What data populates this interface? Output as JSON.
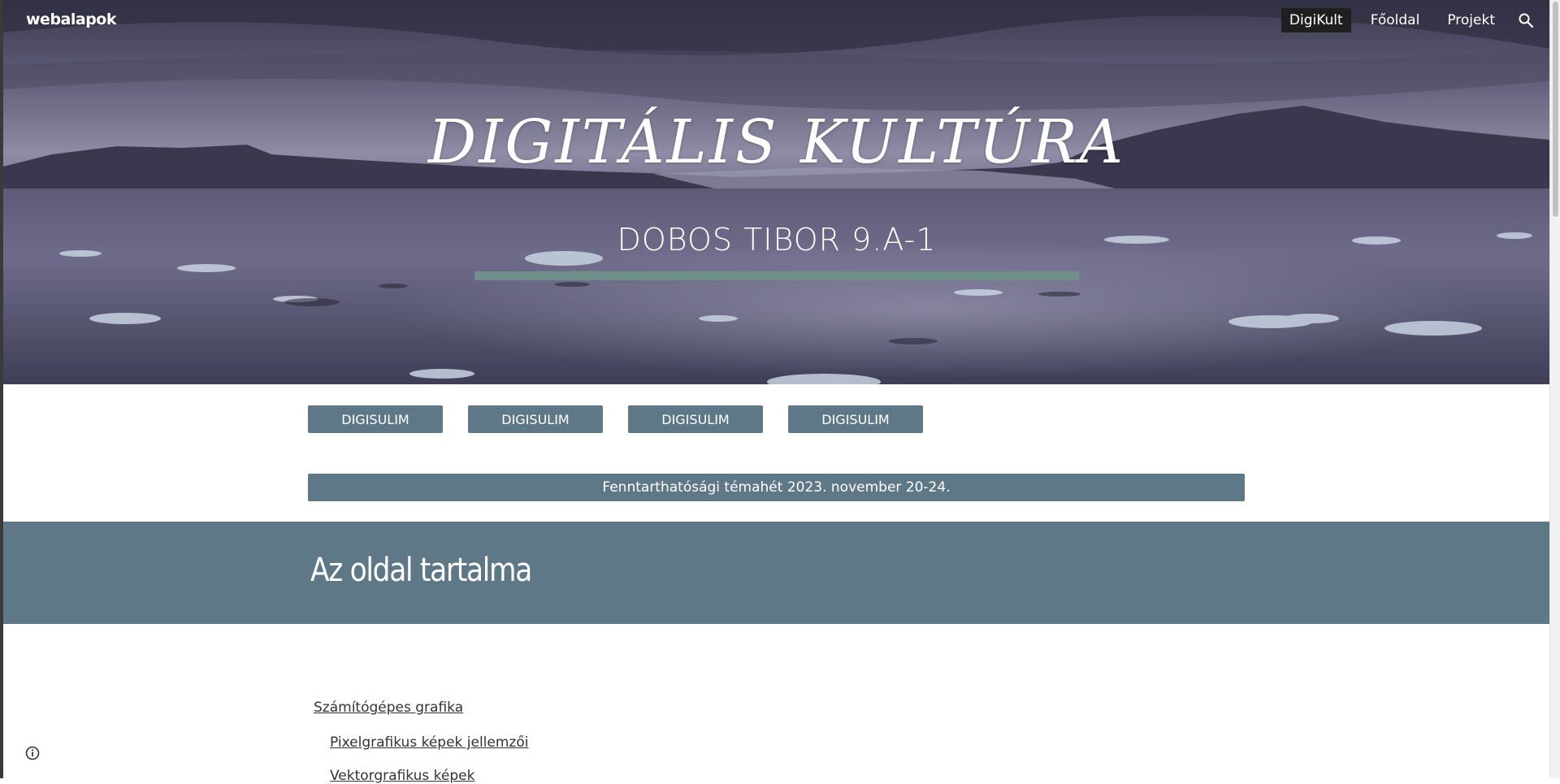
{
  "site": {
    "name": "webalapok"
  },
  "nav": {
    "items": [
      {
        "label": "DigiKult",
        "active": true
      },
      {
        "label": "Főoldal",
        "active": false
      },
      {
        "label": "Projekt",
        "active": false
      }
    ],
    "search_icon": "search-icon"
  },
  "hero": {
    "title": "DIGITÁLIS KULTÚRA",
    "subtitle": "DOBOS TIBOR 9.A-1",
    "accent_color": "#6f8f8a"
  },
  "buttons": [
    "DIGISULIM",
    "DIGISULIM",
    "DIGISULIM",
    "DIGISULIM"
  ],
  "banner": {
    "label": "Fenntarthatósági témahét 2023. november 20-24."
  },
  "section": {
    "heading": "Az oldal tartalma",
    "band_color": "#5f7888"
  },
  "toc": [
    {
      "label": "Számítógépes grafika"
    },
    {
      "label": "Pixelgrafikus képek jellemzői"
    },
    {
      "label": "Vektorgrafikus képek"
    }
  ],
  "footer": {
    "info_icon": "info-icon"
  }
}
